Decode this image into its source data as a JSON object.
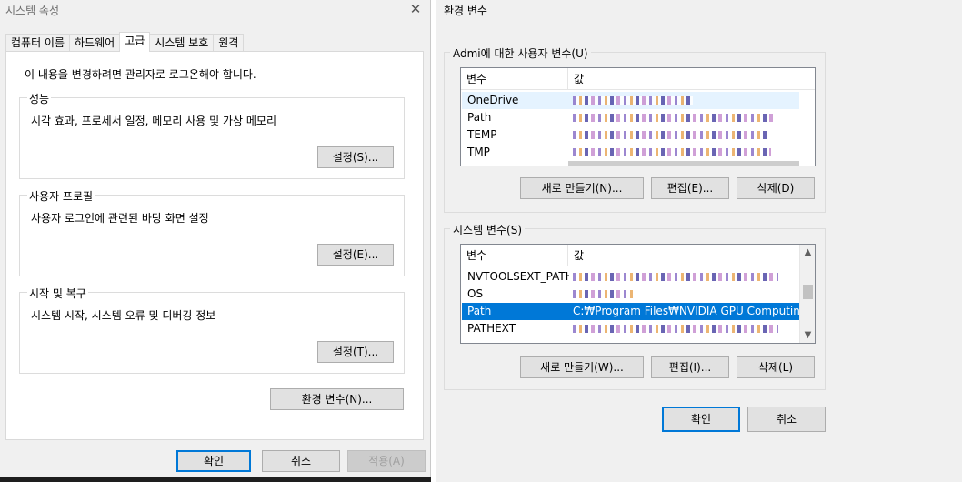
{
  "left_window": {
    "title": "시스템 속성",
    "tabs": [
      {
        "label": "컴퓨터 이름"
      },
      {
        "label": "하드웨어"
      },
      {
        "label": "고급"
      },
      {
        "label": "시스템 보호"
      },
      {
        "label": "원격"
      }
    ],
    "note": "이 내용을 변경하려면 관리자로 로그온해야 합니다.",
    "groups": [
      {
        "legend": "성능",
        "desc": "시각 효과, 프로세서 일정, 메모리 사용 및 가상 메모리",
        "button": "설정(S)..."
      },
      {
        "legend": "사용자 프로필",
        "desc": "사용자 로그인에 관련된 바탕 화면 설정",
        "button": "설정(E)..."
      },
      {
        "legend": "시작 및 복구",
        "desc": "시스템 시작, 시스템 오류 및 디버깅 정보",
        "button": "설정(T)..."
      }
    ],
    "env_button": "환경 변수(N)...",
    "ok": "확인",
    "cancel": "취소",
    "apply": "적용(A)"
  },
  "right_window": {
    "title": "환경 변수",
    "user_group": {
      "legend": "Admi에 대한 사용자 변수(U)",
      "col_var": "변수",
      "col_val": "값",
      "rows": [
        {
          "name": "OneDrive"
        },
        {
          "name": "Path"
        },
        {
          "name": "TEMP"
        },
        {
          "name": "TMP"
        }
      ],
      "new": "새로 만들기(N)...",
      "edit": "편집(E)...",
      "delete": "삭제(D)"
    },
    "system_group": {
      "legend": "시스템 변수(S)",
      "col_var": "변수",
      "col_val": "값",
      "rows": [
        {
          "name": "NVTOOLSEXT_PATH",
          "value": ""
        },
        {
          "name": "OS",
          "value": ""
        },
        {
          "name": "Path",
          "value": "C:₩Program Files₩NVIDIA GPU Computing..."
        },
        {
          "name": "PATHEXT",
          "value": ""
        }
      ],
      "new": "새로 만들기(W)...",
      "edit": "편집(I)...",
      "delete": "삭제(L)"
    },
    "ok": "확인",
    "cancel": "취소"
  },
  "colors": {
    "selection": "#0078d7",
    "window_bg": "#f0f0f0"
  }
}
